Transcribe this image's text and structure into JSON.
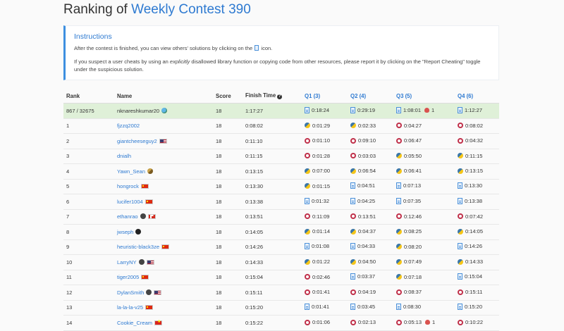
{
  "header": {
    "title_prefix": "Ranking of",
    "contest_name": "Weekly Contest 390"
  },
  "instructions": {
    "title": "Instructions",
    "p1_before": "After the contest is finished, you can view others' solutions by clicking on the",
    "p1_after": "icon.",
    "p2_part1": "If you suspect a user cheats by using an",
    "p2_em": "explicitly",
    "p2_part2": "disallowed library function or copying code from other resources, please report it by clicking on the \"Report Cheating\" toggle under the suspicious solution."
  },
  "table": {
    "headers": {
      "rank": "Rank",
      "name": "Name",
      "score": "Score",
      "finish": "Finish Time",
      "q1": "Q1 (3)",
      "q2": "Q2 (4)",
      "q3": "Q3 (5)",
      "q4": "Q4 (6)"
    },
    "rows": [
      {
        "rank": "867 / 32675",
        "name": "nknareshkumar20",
        "avatar": "globe",
        "flags": [],
        "score": "18",
        "finish": "1:17:27",
        "q": [
          {
            "icon": "doc",
            "t": "0:18:24"
          },
          {
            "icon": "doc",
            "t": "0:29:19"
          },
          {
            "icon": "doc",
            "t": "1:08:01",
            "bug": "1"
          },
          {
            "icon": "doc",
            "t": "1:12:27"
          }
        ]
      },
      {
        "rank": "1",
        "name": "fjzzq2002",
        "avatar": "",
        "flags": [],
        "score": "18",
        "finish": "0:08:02",
        "q": [
          {
            "icon": "py",
            "t": "0:01:29"
          },
          {
            "icon": "py",
            "t": "0:02:33"
          },
          {
            "icon": "cpp",
            "t": "0:04:27"
          },
          {
            "icon": "cpp",
            "t": "0:08:02"
          }
        ]
      },
      {
        "rank": "2",
        "name": "giantcheeseguy2",
        "avatar": "",
        "flags": [
          "us"
        ],
        "score": "18",
        "finish": "0:11:10",
        "q": [
          {
            "icon": "cpp",
            "t": "0:01:10"
          },
          {
            "icon": "cpp",
            "t": "0:09:10"
          },
          {
            "icon": "cpp",
            "t": "0:06:47"
          },
          {
            "icon": "cpp",
            "t": "0:04:32"
          }
        ]
      },
      {
        "rank": "3",
        "name": "dnialh",
        "avatar": "",
        "flags": [],
        "score": "18",
        "finish": "0:11:15",
        "q": [
          {
            "icon": "cpp",
            "t": "0:01:28"
          },
          {
            "icon": "cpp",
            "t": "0:03:03"
          },
          {
            "icon": "py",
            "t": "0:05:50"
          },
          {
            "icon": "py",
            "t": "0:11:15"
          }
        ]
      },
      {
        "rank": "4",
        "name": "Yawn_Sean",
        "avatar": "cube",
        "flags": [],
        "score": "18",
        "finish": "0:13:15",
        "q": [
          {
            "icon": "py",
            "t": "0:07:00"
          },
          {
            "icon": "py",
            "t": "0:06:54"
          },
          {
            "icon": "py",
            "t": "0:06:41"
          },
          {
            "icon": "py",
            "t": "0:13:15"
          }
        ]
      },
      {
        "rank": "5",
        "name": "hongrock",
        "avatar": "",
        "flags": [
          "cn"
        ],
        "score": "18",
        "finish": "0:13:30",
        "q": [
          {
            "icon": "py",
            "t": "0:01:15"
          },
          {
            "icon": "doc",
            "t": "0:04:51"
          },
          {
            "icon": "doc",
            "t": "0:07:13"
          },
          {
            "icon": "doc",
            "t": "0:13:30"
          }
        ]
      },
      {
        "rank": "6",
        "name": "lucifer1004",
        "avatar": "",
        "flags": [
          "cn"
        ],
        "score": "18",
        "finish": "0:13:38",
        "q": [
          {
            "icon": "doc",
            "t": "0:01:32"
          },
          {
            "icon": "doc",
            "t": "0:04:25"
          },
          {
            "icon": "doc",
            "t": "0:07:35"
          },
          {
            "icon": "doc",
            "t": "0:13:38"
          }
        ]
      },
      {
        "rank": "7",
        "name": "ethanrao",
        "avatar": "dark",
        "flags": [
          "ca"
        ],
        "score": "18",
        "finish": "0:13:51",
        "q": [
          {
            "icon": "cpp",
            "t": "0:11:09"
          },
          {
            "icon": "cpp",
            "t": "0:13:51"
          },
          {
            "icon": "cpp",
            "t": "0:12:46"
          },
          {
            "icon": "cpp",
            "t": "0:07:42"
          }
        ]
      },
      {
        "rank": "8",
        "name": "jwseph",
        "avatar": "black",
        "flags": [],
        "score": "18",
        "finish": "0:14:05",
        "q": [
          {
            "icon": "py",
            "t": "0:01:14"
          },
          {
            "icon": "py",
            "t": "0:04:37"
          },
          {
            "icon": "py",
            "t": "0:08:25"
          },
          {
            "icon": "py",
            "t": "0:14:05"
          }
        ]
      },
      {
        "rank": "9",
        "name": "heuristic-black3ze",
        "avatar": "",
        "flags": [
          "cn"
        ],
        "score": "18",
        "finish": "0:14:26",
        "q": [
          {
            "icon": "doc",
            "t": "0:01:08"
          },
          {
            "icon": "doc",
            "t": "0:04:33"
          },
          {
            "icon": "py",
            "t": "0:08:20"
          },
          {
            "icon": "doc",
            "t": "0:14:26"
          }
        ]
      },
      {
        "rank": "10",
        "name": "LarryNY",
        "avatar": "dark",
        "flags": [
          "us"
        ],
        "score": "18",
        "finish": "0:14:33",
        "q": [
          {
            "icon": "py",
            "t": "0:01:22"
          },
          {
            "icon": "py",
            "t": "0:04:50"
          },
          {
            "icon": "py",
            "t": "0:07:49"
          },
          {
            "icon": "py",
            "t": "0:14:33"
          }
        ]
      },
      {
        "rank": "11",
        "name": "tiger2005",
        "avatar": "",
        "flags": [
          "cn"
        ],
        "score": "18",
        "finish": "0:15:04",
        "q": [
          {
            "icon": "cpp",
            "t": "0:02:46"
          },
          {
            "icon": "doc",
            "t": "0:03:37"
          },
          {
            "icon": "py",
            "t": "0:07:18"
          },
          {
            "icon": "doc",
            "t": "0:15:04"
          }
        ]
      },
      {
        "rank": "12",
        "name": "DylanSmith",
        "avatar": "dark",
        "flags": [
          "us"
        ],
        "score": "18",
        "finish": "0:15:11",
        "q": [
          {
            "icon": "cpp",
            "t": "0:01:41"
          },
          {
            "icon": "cpp",
            "t": "0:04:19"
          },
          {
            "icon": "cpp",
            "t": "0:08:37"
          },
          {
            "icon": "cpp",
            "t": "0:15:11"
          }
        ]
      },
      {
        "rank": "13",
        "name": "la-la-la-v25",
        "avatar": "",
        "flags": [
          "cn"
        ],
        "score": "18",
        "finish": "0:15:20",
        "q": [
          {
            "icon": "doc",
            "t": "0:01:41"
          },
          {
            "icon": "doc",
            "t": "0:03:45"
          },
          {
            "icon": "doc",
            "t": "0:08:30"
          },
          {
            "icon": "doc",
            "t": "0:15:20"
          }
        ]
      },
      {
        "rank": "14",
        "name": "Cookie_Cream",
        "avatar": "",
        "flags": [
          "vn"
        ],
        "score": "18",
        "finish": "0:15:22",
        "q": [
          {
            "icon": "cpp",
            "t": "0:01:06"
          },
          {
            "icon": "cpp",
            "t": "0:02:13"
          },
          {
            "icon": "cpp",
            "t": "0:05:13",
            "bug": "1"
          },
          {
            "icon": "cpp",
            "t": "0:10:22"
          }
        ]
      }
    ]
  }
}
